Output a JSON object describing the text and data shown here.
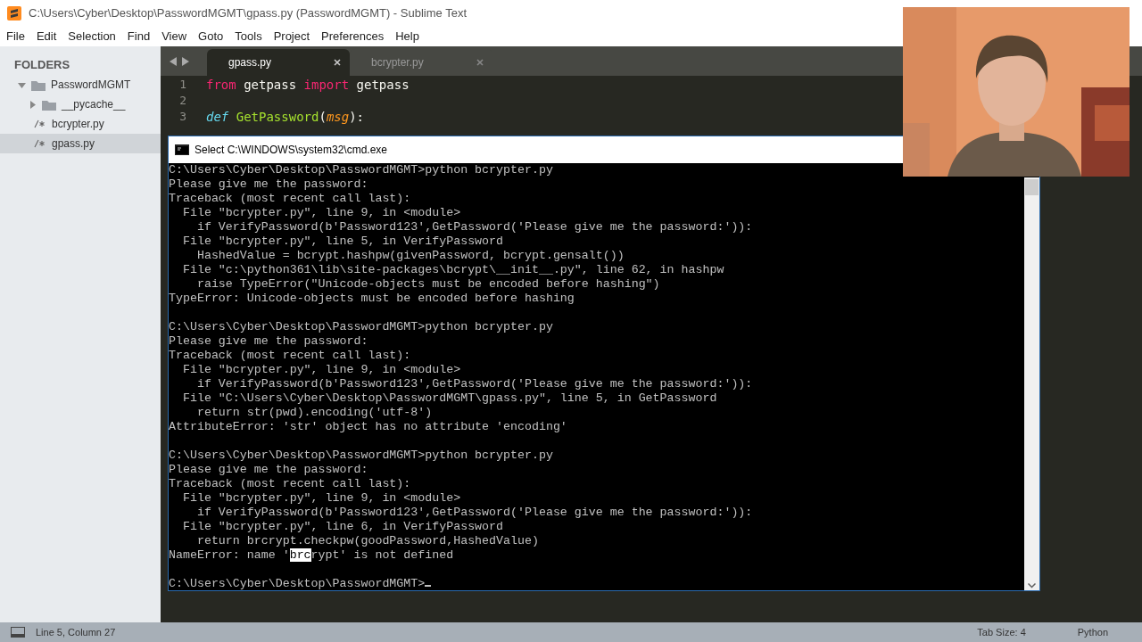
{
  "window": {
    "title": "C:\\Users\\Cyber\\Desktop\\PasswordMGMT\\gpass.py (PasswordMGMT) - Sublime Text"
  },
  "menu": [
    "File",
    "Edit",
    "Selection",
    "Find",
    "View",
    "Goto",
    "Tools",
    "Project",
    "Preferences",
    "Help"
  ],
  "sidebar": {
    "header": "FOLDERS",
    "items": [
      {
        "label": "PasswordMGMT",
        "kind": "folder",
        "expanded": true,
        "selected": false,
        "children": [
          {
            "label": "__pycache__",
            "kind": "folder",
            "expanded": false,
            "selected": false
          },
          {
            "label": "bcrypter.py",
            "kind": "file",
            "selected": false
          },
          {
            "label": "gpass.py",
            "kind": "file",
            "selected": true
          }
        ]
      }
    ]
  },
  "tabs": [
    {
      "label": "gpass.py",
      "selected": true
    },
    {
      "label": "bcrypter.py",
      "selected": false
    }
  ],
  "editor": {
    "lines": [
      {
        "number": "1",
        "tokens": [
          {
            "text": "from",
            "kind": "keyword"
          },
          {
            "text": " getpass ",
            "kind": "plain"
          },
          {
            "text": "import",
            "kind": "keyword"
          },
          {
            "text": " getpass",
            "kind": "plain"
          }
        ]
      },
      {
        "number": "2"
      },
      {
        "number": "3",
        "tokens": [
          {
            "text": "def ",
            "kind": "storage"
          },
          {
            "text": "GetPassword",
            "kind": "function"
          },
          {
            "text": "(",
            "kind": "plain"
          },
          {
            "text": "msg",
            "kind": "param"
          },
          {
            "text": "):",
            "kind": "plain"
          }
        ]
      }
    ]
  },
  "console": {
    "title": "Select C:\\WINDOWS\\system32\\cmd.exe",
    "cursor": true,
    "lines": [
      "C:\\Users\\Cyber\\Desktop\\PasswordMGMT>python bcrypter.py",
      "Please give me the password:",
      "Traceback (most recent call last):",
      "  File \"bcrypter.py\", line 9, in <module>",
      "    if VerifyPassword(b'Password123',GetPassword('Please give me the password:')):",
      "  File \"bcrypter.py\", line 5, in VerifyPassword",
      "    HashedValue = bcrypt.hashpw(givenPassword, bcrypt.gensalt())",
      "  File \"c:\\python361\\lib\\site-packages\\bcrypt\\__init__.py\", line 62, in hashpw",
      "    raise TypeError(\"Unicode-objects must be encoded before hashing\")",
      "TypeError: Unicode-objects must be encoded before hashing",
      {
        "kind": "blank"
      },
      "C:\\Users\\Cyber\\Desktop\\PasswordMGMT>python bcrypter.py",
      "Please give me the password:",
      "Traceback (most recent call last):",
      "  File \"bcrypter.py\", line 9, in <module>",
      "    if VerifyPassword(b'Password123',GetPassword('Please give me the password:')):",
      "  File \"C:\\Users\\Cyber\\Desktop\\PasswordMGMT\\gpass.py\", line 5, in GetPassword",
      "    return str(pwd).encoding('utf-8')",
      "AttributeError: 'str' object has no attribute 'encoding'",
      {
        "kind": "blank"
      },
      "C:\\Users\\Cyber\\Desktop\\PasswordMGMT>python bcrypter.py",
      "Please give me the password:",
      "Traceback (most recent call last):",
      "  File \"bcrypter.py\", line 9, in <module>",
      "    if VerifyPassword(b'Password123',GetPassword('Please give me the password:')):",
      "  File \"bcrypter.py\", line 6, in VerifyPassword",
      "    return brcrypt.checkpw(goodPassword,HashedValue)",
      {
        "kind": "parts",
        "parts": [
          {
            "text": "NameError: name '",
            "selected": false
          },
          {
            "text": "brc",
            "selected": true
          },
          {
            "text": "rypt' is not defined",
            "selected": false
          }
        ]
      },
      {
        "kind": "blank"
      },
      "C:\\Users\\Cyber\\Desktop\\PasswordMGMT>"
    ]
  },
  "status_bar": {
    "position": "Line 5, Column 27",
    "tab_size": "Tab Size: 4",
    "syntax": "Python"
  }
}
